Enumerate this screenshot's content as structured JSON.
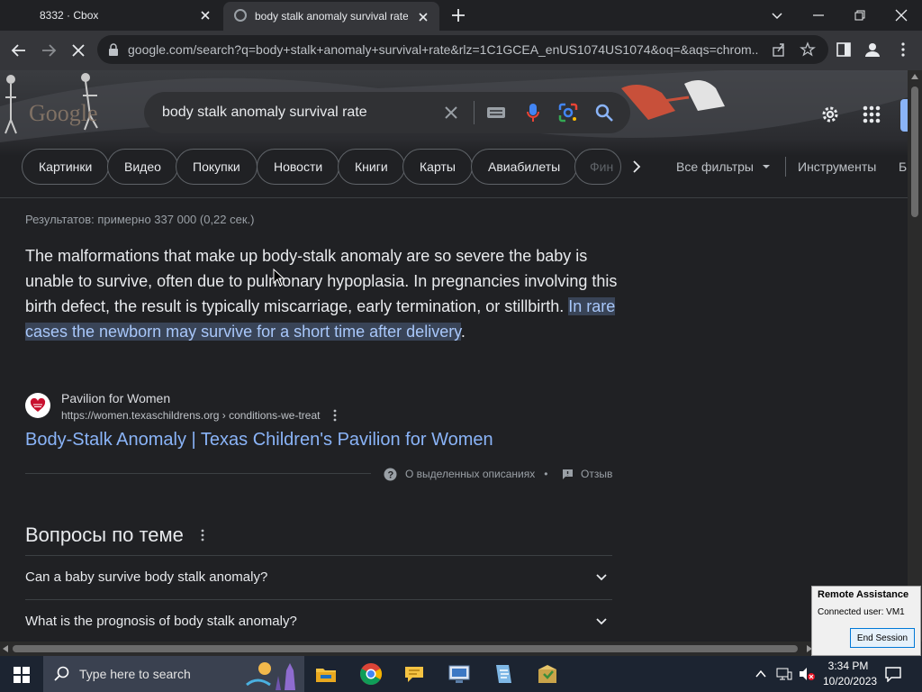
{
  "browser": {
    "tabs": [
      {
        "title": "8332 · Cbox",
        "active": false
      },
      {
        "title": "body stalk anomaly survival rate",
        "active": true
      }
    ],
    "url": "google.com/search?q=body+stalk+anomaly+survival+rate&rlz=1C1GCEA_enUS1074US1074&oq=&aqs=chrom..."
  },
  "search": {
    "logo_text": "Google",
    "query": "body stalk anomaly survival rate"
  },
  "filters": {
    "chips": [
      "Картинки",
      "Видео",
      "Покупки",
      "Новости",
      "Книги",
      "Карты",
      "Авиабилеты",
      "Фин"
    ],
    "all_filters": "Все фильтры",
    "tools": "Инструменты",
    "cut_off": "Б"
  },
  "results": {
    "stats": "Результатов: примерно 337 000 (0,22 сек.)",
    "snippet_plain": "The malformations that make up body-stalk anomaly are so severe the baby is unable to survive, often due to pulmonary hypoplasia. In pregnancies involving this birth defect, the result is typically miscarriage, early termination, or stillbirth. ",
    "snippet_highlight": "In rare cases the newborn may survive for a short time after delivery",
    "snippet_end": ".",
    "source": {
      "site_name": "Pavilion for Women",
      "url": "https://women.texaschildrens.org › conditions-we-treat",
      "link_title": "Body-Stalk Anomaly | Texas Children's Pavilion for Women"
    },
    "about_snippets": "О выделенных описаниях",
    "separator": "•",
    "feedback": "Отзыв"
  },
  "people_also_ask": {
    "title": "Вопросы по теме",
    "questions": [
      "Can a baby survive body stalk anomaly?",
      "What is the prognosis of body stalk anomaly?"
    ]
  },
  "remote_assistance": {
    "title": "Remote Assistance",
    "connected": "Connected user:  VM1",
    "end_session": "End Session"
  },
  "taskbar": {
    "search_placeholder": "Type here to search",
    "time": "3:34 PM",
    "date": "10/20/2023"
  },
  "colors": {
    "page_bg": "#202124",
    "link": "#8ab4f8",
    "highlight_bg": "#394457",
    "highlight_text": "#a8c7fa"
  }
}
